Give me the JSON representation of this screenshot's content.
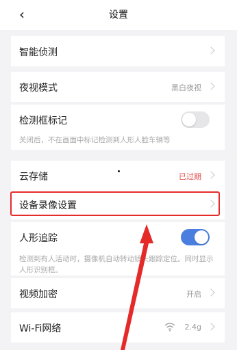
{
  "header": {
    "back_icon": "chevron-left-icon",
    "title": "设置"
  },
  "rows": {
    "smart_detect": {
      "label": "智能侦测"
    },
    "night_vision": {
      "label": "夜视模式",
      "value": "黑白夜视"
    },
    "detect_frame": {
      "label": "检测框标记",
      "toggle_state": "off",
      "description": "关闭后，不在画面中标记检测到人形人脸车辆等"
    },
    "cloud_storage": {
      "label": "云存储",
      "value": "已过期",
      "value_color": "#e04a4a"
    },
    "device_recording": {
      "label": "设备录像设置"
    },
    "human_tracking": {
      "label": "人形追踪",
      "toggle_state": "on",
      "description": "检测到有人活动时，摄像机自动转动镜头跟踪定位。同时显示人形识别框。"
    },
    "video_encryption": {
      "label": "视频加密",
      "value": "开启"
    },
    "wifi": {
      "label": "Wi-Fi网络",
      "value": "2.4g",
      "icon": "wifi-icon"
    }
  },
  "annotation": {
    "highlight_color": "#e52a2a",
    "arrow_color": "#e52a2a"
  }
}
